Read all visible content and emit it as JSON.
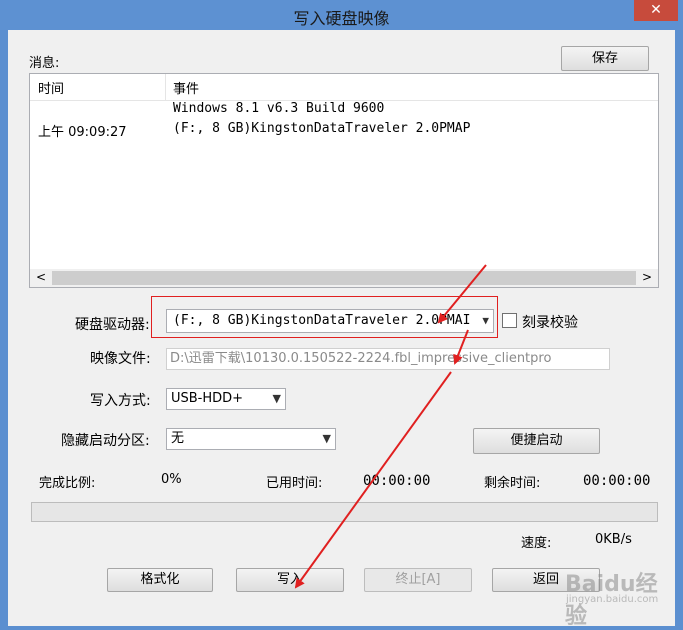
{
  "window": {
    "title": "写入硬盘映像",
    "close_glyph": "✕"
  },
  "messages": {
    "label": "消息:",
    "save_button": "保存",
    "columns": [
      "时间",
      "事件"
    ],
    "rows": [
      {
        "time": "",
        "event": "Windows 8.1 v6.3 Build 9600"
      },
      {
        "time": "上午 09:09:27",
        "event": "(F:, 8 GB)KingstonDataTraveler 2.0PMAP"
      }
    ],
    "scroll_left": "<",
    "scroll_right": ">"
  },
  "form": {
    "drive_label": "硬盘驱动器:",
    "drive_value": "(F:, 8 GB)KingstonDataTraveler 2.0PMAI",
    "verify_label": "刻录校验",
    "verify_checked": false,
    "image_label": "映像文件:",
    "image_value": "D:\\迅雷下载\\10130.0.150522-2224.fbl_impressive_clientpro",
    "write_mode_label": "写入方式:",
    "write_mode_value": "USB-HDD+",
    "hidden_partition_label": "隐藏启动分区:",
    "hidden_partition_value": "无",
    "quick_start_button": "便捷启动"
  },
  "status": {
    "complete_label": "完成比例:",
    "complete_value": "0%",
    "complete_fraction": 0,
    "elapsed_label": "已用时间:",
    "elapsed_value": "00:00:00",
    "remaining_label": "剩余时间:",
    "remaining_value": "00:00:00",
    "speed_label": "速度:",
    "speed_value": "0KB/s"
  },
  "buttons": {
    "format": "格式化",
    "write": "写入",
    "abort": "终止[A]",
    "back": "返回"
  },
  "annotation_color": "#e02020",
  "watermark": {
    "text": "Baidu经验",
    "url": "jingyan.baidu.com"
  },
  "colors": {
    "titlebar": "#5d91d2",
    "close": "#c74b3c"
  }
}
